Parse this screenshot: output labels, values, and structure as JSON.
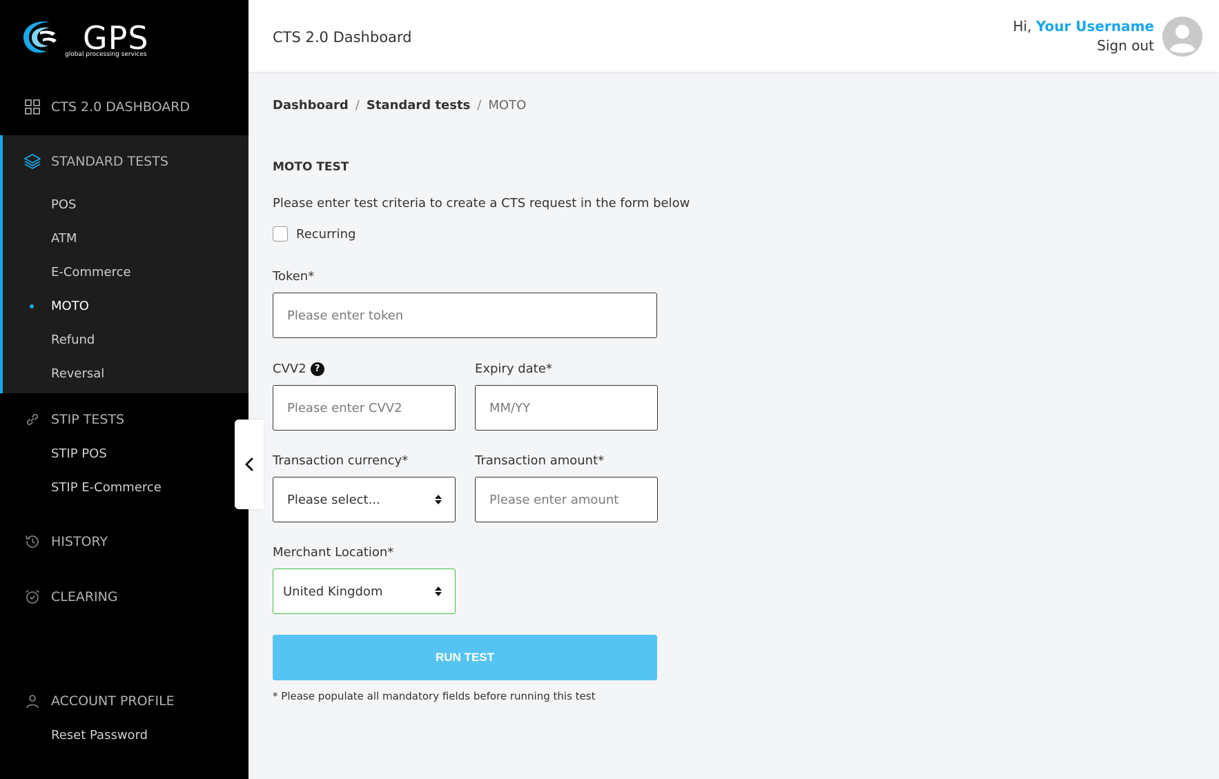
{
  "logo": {
    "text": "GPS",
    "subtitle": "global processing services",
    "icon": "gps-swoosh-icon"
  },
  "sidebar": {
    "dashboard": {
      "label": "CTS 2.0 DASHBOARD",
      "icon": "grid-icon"
    },
    "standard": {
      "label": "STANDARD TESTS",
      "icon": "layers-icon",
      "items": [
        {
          "label": "POS"
        },
        {
          "label": "ATM"
        },
        {
          "label": "E-Commerce"
        },
        {
          "label": "MOTO",
          "active": true
        },
        {
          "label": "Refund"
        },
        {
          "label": "Reversal"
        }
      ]
    },
    "stip": {
      "label": "STIP TESTS",
      "icon": "link-icon",
      "items": [
        {
          "label": "STIP POS"
        },
        {
          "label": "STIP E-Commerce"
        }
      ]
    },
    "history": {
      "label": "HISTORY",
      "icon": "history-icon"
    },
    "clearing": {
      "label": "CLEARING",
      "icon": "alarm-clock-icon"
    },
    "account": {
      "label": "ACCOUNT PROFILE",
      "icon": "user-icon",
      "items": [
        {
          "label": "Reset Password"
        }
      ]
    }
  },
  "header": {
    "title": "CTS 2.0 Dashboard",
    "greeting": "Hi, ",
    "username": "Your Username",
    "signout": "Sign out"
  },
  "breadcrumb": {
    "items": [
      "Dashboard",
      "Standard tests"
    ],
    "current": "MOTO",
    "separator": "/"
  },
  "form": {
    "title": "MOTO TEST",
    "description": "Please enter test criteria to create a CTS request in the form below",
    "recurring_label": "Recurring",
    "token": {
      "label": "Token*",
      "placeholder": "Please enter token"
    },
    "cvv2": {
      "label": "CVV2",
      "placeholder": "Please enter CVV2",
      "help": "?"
    },
    "expiry": {
      "label": "Expiry date*",
      "placeholder": "MM/YY"
    },
    "currency": {
      "label": "Transaction currency*",
      "value": "Please select..."
    },
    "amount": {
      "label": "Transaction amount*",
      "placeholder": "Please enter amount"
    },
    "location": {
      "label": "Merchant Location*",
      "value": "United Kingdom"
    },
    "run_label": "RUN TEST",
    "note": "* Please populate all mandatory fields before running this test"
  },
  "colors": {
    "accent": "#1aa7e8",
    "button": "#56c4f0",
    "sidebar_bg": "#000000",
    "valid_border": "#3fbf3f"
  }
}
